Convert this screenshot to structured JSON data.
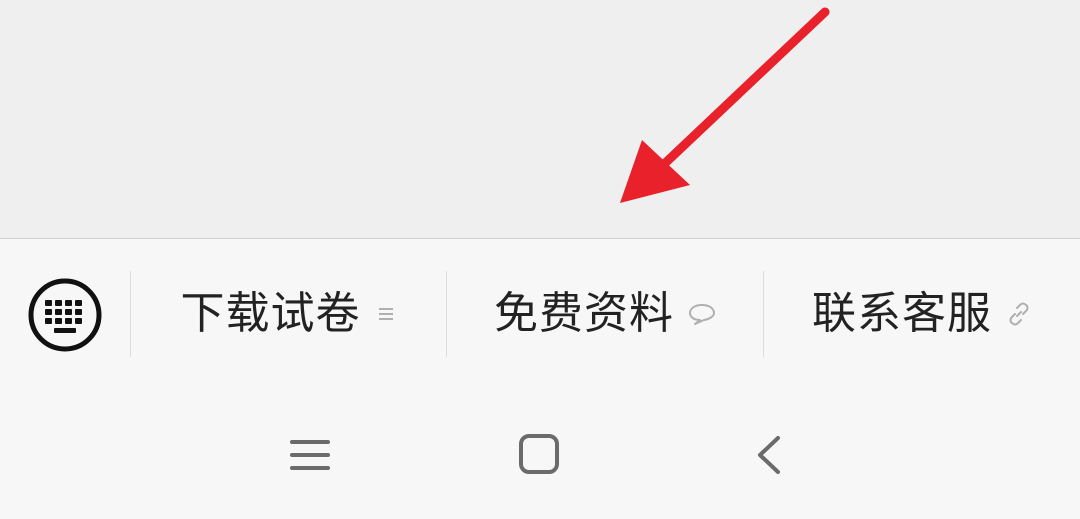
{
  "menu": {
    "keyboard_icon": "keyboard-icon",
    "items": [
      {
        "label": "下载试卷",
        "icon": "submenu-lines-icon"
      },
      {
        "label": "免费资料",
        "icon": "chat-bubble-icon"
      },
      {
        "label": "联系客服",
        "icon": "link-icon"
      }
    ]
  },
  "nav": {
    "recents_icon": "recents-icon",
    "home_icon": "home-icon",
    "back_icon": "back-icon"
  },
  "colors": {
    "arrow": "#e8212b",
    "menu_text": "#222222",
    "secondary_icon": "#b0b0b0",
    "nav_icon": "#6b6b6b"
  }
}
